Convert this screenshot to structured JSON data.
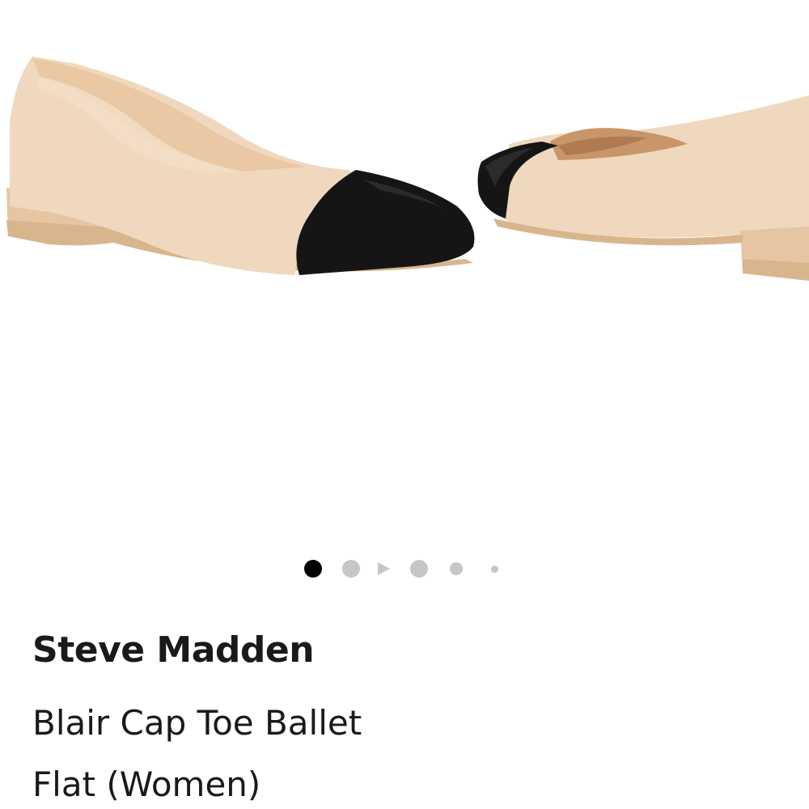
{
  "product": {
    "brand": "Steve Madden",
    "title_line1": "Blair Cap Toe Ballet",
    "title_line2": "Flat (Women)"
  },
  "gallery": {
    "image_alt": "Blair Cap Toe Ballet Flat (Women)",
    "items": [
      {
        "type": "image",
        "active": true
      },
      {
        "type": "image",
        "active": false
      },
      {
        "type": "video",
        "active": false
      },
      {
        "type": "image",
        "active": false
      },
      {
        "type": "image",
        "active": false
      },
      {
        "type": "image",
        "active": false
      }
    ]
  },
  "colors": {
    "shoe_body": "#efd8bd",
    "shoe_toe_cap": "#151515",
    "sole": "#d9b58e",
    "lining": "#e9c8a3",
    "dot_active": "#000000",
    "dot_inactive": "#c6c6c6",
    "text": "#1a1a1a"
  },
  "icons": {
    "play": "play-icon"
  }
}
